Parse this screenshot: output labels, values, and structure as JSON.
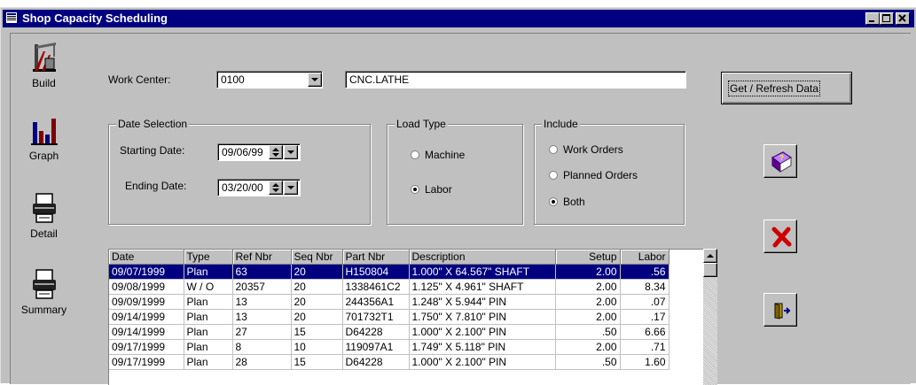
{
  "window": {
    "title": "Shop Capacity Scheduling"
  },
  "nav": {
    "build": "Build",
    "graph": "Graph",
    "detail": "Detail",
    "summary": "Summary"
  },
  "form": {
    "work_center_label": "Work Center:",
    "work_center_value": "0100",
    "work_center_desc": "CNC.LATHE",
    "refresh_button": "Get / Refresh Data",
    "date_group": "Date Selection",
    "start_label": "Starting Date:",
    "start_value": "09/06/99",
    "end_label": "Ending Date:",
    "end_value": "03/20/00",
    "load_group": "Load Type",
    "load_options": [
      "Machine",
      "Labor"
    ],
    "load_selected": "Labor",
    "include_group": "Include",
    "include_options": [
      "Work Orders",
      "Planned Orders",
      "Both"
    ],
    "include_selected": "Both"
  },
  "table": {
    "headers": [
      "Date",
      "Type",
      "Ref Nbr",
      "Seq Nbr",
      "Part Nbr",
      "Description",
      "Setup",
      "Labor"
    ],
    "rows": [
      [
        "09/07/1999",
        "Plan",
        "63",
        "20",
        "H150804",
        "1.000\" X 64.567\" SHAFT",
        "2.00",
        ".56"
      ],
      [
        "09/08/1999",
        "W / O",
        "20357",
        "20",
        "1338461C2",
        "1.125\" X 4.961\" SHAFT",
        "2.00",
        "8.34"
      ],
      [
        "09/09/1999",
        "Plan",
        "13",
        "20",
        "244356A1",
        "1.248\" X 5.944\" PIN",
        "2.00",
        ".07"
      ],
      [
        "09/14/1999",
        "Plan",
        "13",
        "20",
        "701732T1",
        "1.750\" X 7.810\" PIN",
        "2.00",
        ".17"
      ],
      [
        "09/14/1999",
        "Plan",
        "27",
        "15",
        "D64228",
        "1.000\" X 2.100\" PIN",
        ".50",
        "6.66"
      ],
      [
        "09/17/1999",
        "Plan",
        "8",
        "10",
        "119097A1",
        "1.749\" X 5.118\" PIN",
        "2.00",
        ".71"
      ],
      [
        "09/17/1999",
        "Plan",
        "28",
        "15",
        "D64228",
        "1.000\" X 2.100\" PIN",
        ".50",
        "1.60"
      ]
    ]
  },
  "icons": {
    "build": "crane-icon",
    "graph": "bar-chart-icon",
    "detail": "printer-icon",
    "summary": "printer-icon",
    "help": "help-book-icon",
    "cancel": "red-x-icon",
    "exit": "exit-door-icon"
  }
}
